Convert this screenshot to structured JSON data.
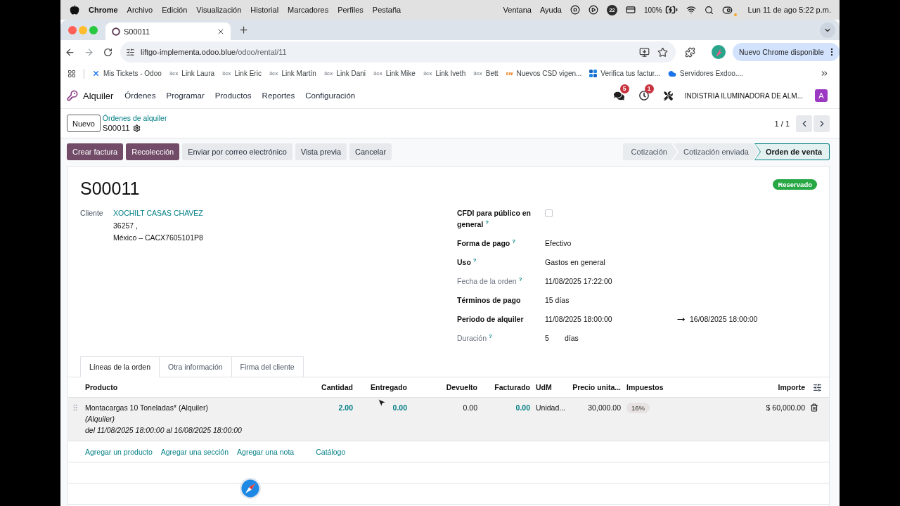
{
  "menubar": {
    "app": "Chrome",
    "menus": [
      "Archivo",
      "Edición",
      "Visualización",
      "Historial",
      "Marcadores",
      "Perfiles",
      "Pestaña"
    ],
    "right_menus": [
      "Ventana",
      "Ayuda"
    ],
    "badge_count": "22",
    "battery": "100%",
    "clock": "Lun 11 de ago 5:22 p.m."
  },
  "browser": {
    "tabs": [
      {
        "title": "S00011",
        "selected": true
      }
    ],
    "url": {
      "host": "liftgo-implementa.odoo.blue",
      "path": "/odoo/rental/11"
    },
    "update_button": "Nuevo Chrome disponible",
    "bookmarks": [
      {
        "label": "Mis Tickets - Odoo",
        "kind": "x"
      },
      {
        "label": "Link Laura",
        "kind": "text_muted",
        "icon_text": "3cx"
      },
      {
        "label": "Link Eric",
        "kind": "text_muted",
        "icon_text": "3cx"
      },
      {
        "label": "Link Martín",
        "kind": "text_muted",
        "icon_text": "3cx"
      },
      {
        "label": "Link Dani",
        "kind": "text_muted",
        "icon_text": "3cx"
      },
      {
        "label": "Link Mike",
        "kind": "text_muted",
        "icon_text": "3cx"
      },
      {
        "label": "Link Iveth",
        "kind": "text_muted",
        "icon_text": "3cx"
      },
      {
        "label": "Bett",
        "kind": "text_muted",
        "icon_text": "3cx"
      },
      {
        "label": "Nuevos CSD vigen...",
        "kind": "text_accent",
        "icon_text": "sw"
      },
      {
        "label": "Verifica tus factur...",
        "kind": "squares"
      },
      {
        "label": "Servidores Exdoo....",
        "kind": "cloud"
      }
    ]
  },
  "navbar": {
    "app": "Alquiler",
    "menus": [
      "Órdenes",
      "Programar",
      "Productos",
      "Reportes",
      "Configuración"
    ],
    "messages_badge": "5",
    "activities_badge": "1",
    "company": "INDISTRIA ILUMINADORA DE ALM...",
    "avatar": "A"
  },
  "control_panel": {
    "new_button": "Nuevo",
    "breadcrumb": "Órdenes de alquiler",
    "record": "S00011",
    "pager": "1 / 1"
  },
  "actions": [
    {
      "label": "Crear factura",
      "kind": "primary"
    },
    {
      "label": "Recolección",
      "kind": "primary"
    },
    {
      "label": "Enviar por correo electrónico",
      "kind": "secondary"
    },
    {
      "label": "Vista previa",
      "kind": "secondary"
    },
    {
      "label": "Cancelar",
      "kind": "secondary"
    }
  ],
  "status_steps": [
    {
      "label": "Cotización",
      "selected": false
    },
    {
      "label": "Cotización enviada",
      "selected": false
    },
    {
      "label": "Orden de venta",
      "selected": true
    }
  ],
  "sheet": {
    "title": "S00011",
    "badge": "Reservado",
    "customer": {
      "label": "Cliente",
      "name": "XOCHILT CASAS CHAVEZ",
      "address_lines": [
        "36257 ,",
        "México – CACX7605101P8"
      ]
    },
    "fields": [
      {
        "kind": "checkbox",
        "label": "CFDI para público en general",
        "help": "?",
        "readonly": false,
        "checked": false
      },
      {
        "kind": "text",
        "label": "Forma de pago",
        "help": "?",
        "readonly": false,
        "value": "Efectivo"
      },
      {
        "kind": "text",
        "label": "Uso",
        "help": "?",
        "readonly": false,
        "value": "Gastos en general"
      },
      {
        "kind": "text",
        "label": "Fecha de la orden",
        "help": "?",
        "readonly": true,
        "value": "11/08/2025 17:22:00"
      },
      {
        "kind": "text",
        "label": "Términos de pago",
        "readonly": false,
        "value": "15 días"
      },
      {
        "kind": "range",
        "label": "Periodo de alquiler",
        "readonly": false,
        "start": "11/08/2025 18:00:00",
        "end": "16/08/2025 18:00:00"
      },
      {
        "kind": "duration",
        "label": "Duración",
        "help": "?",
        "readonly": true,
        "value": "5",
        "unit": "días"
      }
    ]
  },
  "notebook": {
    "tabs": [
      {
        "label": "Líneas de la orden",
        "selected": true
      },
      {
        "label": "Otra información",
        "selected": false
      },
      {
        "label": "Firma del cliente",
        "selected": false
      }
    ]
  },
  "order_lines": {
    "columns": [
      "Producto",
      "Cantidad",
      "Entregado",
      "Devuelto",
      "Facturado",
      "UdM",
      "Precio unita...",
      "Impuestos",
      "Importe"
    ],
    "rows": [
      {
        "highlighted": true,
        "product": "Montacargas 10 Toneladas* (Alquiler)",
        "description_lines": [
          "(Alquiler)",
          "del 11/08/2025 18:00:00 al 16/08/2025 18:00:00"
        ],
        "quantity": "2.00",
        "delivered": "0.00",
        "returned": "0.00",
        "invoiced": "0.00",
        "uom": "Unidad...",
        "price": "30,000.00",
        "tax": "16%",
        "subtotal": "$ 60,000.00"
      }
    ],
    "add_links": [
      "Agregar un producto",
      "Agregar una sección",
      "Agregar una nota"
    ],
    "catalog": "Catálogo"
  }
}
